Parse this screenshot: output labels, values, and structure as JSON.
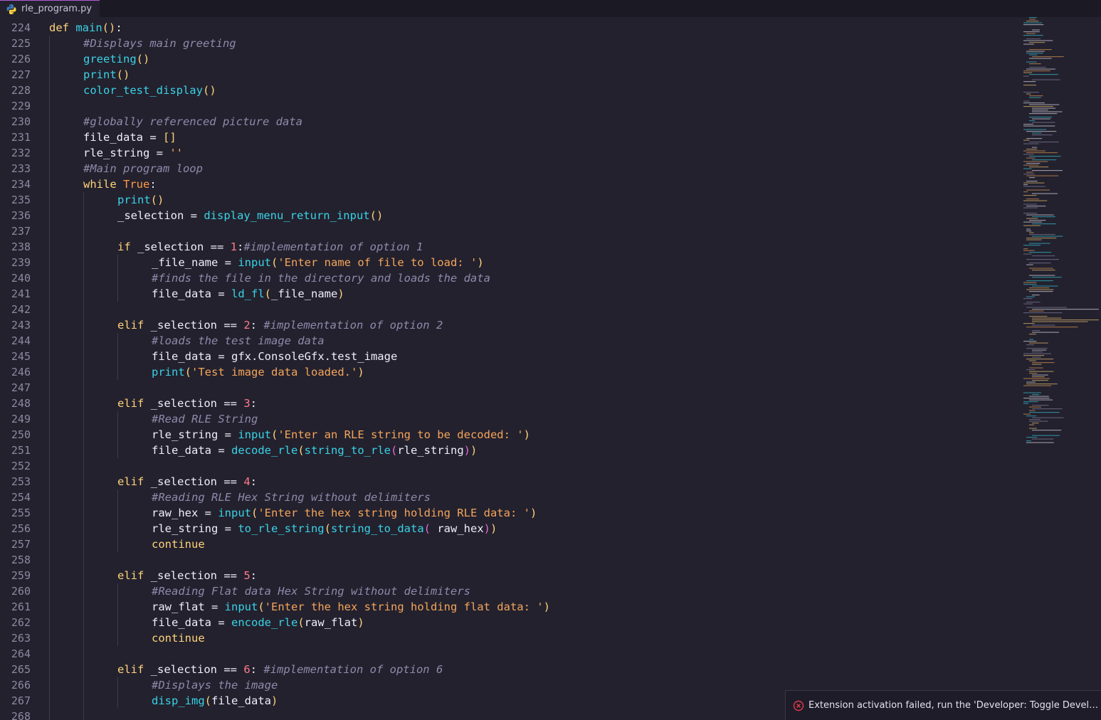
{
  "tab": {
    "filename": "rle_program.py",
    "icon": "python-icon"
  },
  "colors": {
    "background": "#23212e",
    "keyword": "#ffd479",
    "function": "#39d3e6",
    "comment": "#8f8aab",
    "string": "#f5a55a",
    "number": "#ff7a8a",
    "error": "#e03c48"
  },
  "code_lines": [
    {
      "n": "224",
      "indent": 0,
      "tokens": [
        [
          "kw",
          "def "
        ],
        [
          "fn",
          "main"
        ],
        [
          "p1",
          "()"
        ],
        [
          "op",
          ":"
        ]
      ]
    },
    {
      "n": "225",
      "indent": 1,
      "tokens": [
        [
          "cm",
          "#Displays main greeting"
        ]
      ]
    },
    {
      "n": "226",
      "indent": 1,
      "tokens": [
        [
          "fn",
          "greeting"
        ],
        [
          "p1",
          "()"
        ]
      ]
    },
    {
      "n": "227",
      "indent": 1,
      "tokens": [
        [
          "fn",
          "print"
        ],
        [
          "p1",
          "()"
        ]
      ]
    },
    {
      "n": "228",
      "indent": 1,
      "tokens": [
        [
          "fn",
          "color_test_display"
        ],
        [
          "p1",
          "()"
        ]
      ]
    },
    {
      "n": "229",
      "indent": 1,
      "tokens": []
    },
    {
      "n": "230",
      "indent": 1,
      "tokens": [
        [
          "cm",
          "#globally referenced picture data"
        ]
      ]
    },
    {
      "n": "231",
      "indent": 1,
      "tokens": [
        [
          "id",
          "file_data "
        ],
        [
          "op",
          "= "
        ],
        [
          "p1",
          "[]"
        ]
      ]
    },
    {
      "n": "232",
      "indent": 1,
      "tokens": [
        [
          "id",
          "rle_string "
        ],
        [
          "op",
          "= "
        ],
        [
          "st",
          "''"
        ]
      ]
    },
    {
      "n": "233",
      "indent": 1,
      "tokens": [
        [
          "cm",
          "#Main program loop"
        ]
      ]
    },
    {
      "n": "234",
      "indent": 1,
      "tokens": [
        [
          "kw",
          "while "
        ],
        [
          "bi",
          "True"
        ],
        [
          "op",
          ":"
        ]
      ]
    },
    {
      "n": "235",
      "indent": 2,
      "tokens": [
        [
          "fn",
          "print"
        ],
        [
          "p1",
          "()"
        ]
      ]
    },
    {
      "n": "236",
      "indent": 2,
      "tokens": [
        [
          "id",
          "_selection "
        ],
        [
          "op",
          "= "
        ],
        [
          "fn",
          "display_menu_return_input"
        ],
        [
          "p1",
          "()"
        ]
      ]
    },
    {
      "n": "237",
      "indent": 2,
      "tokens": []
    },
    {
      "n": "238",
      "indent": 2,
      "tokens": [
        [
          "kw",
          "if "
        ],
        [
          "id",
          "_selection "
        ],
        [
          "op",
          "== "
        ],
        [
          "nm",
          "1"
        ],
        [
          "op",
          ":"
        ],
        [
          "cm",
          "#implementation of option 1"
        ]
      ]
    },
    {
      "n": "239",
      "indent": 3,
      "tokens": [
        [
          "id",
          "_file_name "
        ],
        [
          "op",
          "= "
        ],
        [
          "fn",
          "input"
        ],
        [
          "p1",
          "("
        ],
        [
          "st",
          "'Enter name of file to load: '"
        ],
        [
          "p1",
          ")"
        ]
      ]
    },
    {
      "n": "240",
      "indent": 3,
      "tokens": [
        [
          "cm",
          "#finds the file in the directory and loads the data"
        ]
      ]
    },
    {
      "n": "241",
      "indent": 3,
      "tokens": [
        [
          "id",
          "file_data "
        ],
        [
          "op",
          "= "
        ],
        [
          "fn",
          "ld_fl"
        ],
        [
          "p1",
          "("
        ],
        [
          "id",
          "_file_name"
        ],
        [
          "p1",
          ")"
        ]
      ]
    },
    {
      "n": "242",
      "indent": 2,
      "tokens": []
    },
    {
      "n": "243",
      "indent": 2,
      "tokens": [
        [
          "kw",
          "elif "
        ],
        [
          "id",
          "_selection "
        ],
        [
          "op",
          "== "
        ],
        [
          "nm",
          "2"
        ],
        [
          "op",
          ": "
        ],
        [
          "cm",
          "#implementation of option 2"
        ]
      ]
    },
    {
      "n": "244",
      "indent": 3,
      "tokens": [
        [
          "cm",
          "#loads the test image data"
        ]
      ]
    },
    {
      "n": "245",
      "indent": 3,
      "tokens": [
        [
          "id",
          "file_data "
        ],
        [
          "op",
          "= "
        ],
        [
          "id",
          "gfx.ConsoleGfx.test_image"
        ]
      ]
    },
    {
      "n": "246",
      "indent": 3,
      "tokens": [
        [
          "fn",
          "print"
        ],
        [
          "p1",
          "("
        ],
        [
          "st",
          "'Test image data loaded.'"
        ],
        [
          "p1",
          ")"
        ]
      ]
    },
    {
      "n": "247",
      "indent": 2,
      "tokens": []
    },
    {
      "n": "248",
      "indent": 2,
      "tokens": [
        [
          "kw",
          "elif "
        ],
        [
          "id",
          "_selection "
        ],
        [
          "op",
          "== "
        ],
        [
          "nm",
          "3"
        ],
        [
          "op",
          ":"
        ]
      ]
    },
    {
      "n": "249",
      "indent": 3,
      "tokens": [
        [
          "cm",
          "#Read RLE String"
        ]
      ]
    },
    {
      "n": "250",
      "indent": 3,
      "tokens": [
        [
          "id",
          "rle_string "
        ],
        [
          "op",
          "= "
        ],
        [
          "fn",
          "input"
        ],
        [
          "p1",
          "("
        ],
        [
          "st",
          "'Enter an RLE string to be decoded: '"
        ],
        [
          "p1",
          ")"
        ]
      ]
    },
    {
      "n": "251",
      "indent": 3,
      "tokens": [
        [
          "id",
          "file_data "
        ],
        [
          "op",
          "= "
        ],
        [
          "fn",
          "decode_rle"
        ],
        [
          "p1",
          "("
        ],
        [
          "fn",
          "string_to_rle"
        ],
        [
          "p2",
          "("
        ],
        [
          "id",
          "rle_string"
        ],
        [
          "p2",
          ")"
        ],
        [
          "p1",
          ")"
        ]
      ]
    },
    {
      "n": "252",
      "indent": 2,
      "tokens": []
    },
    {
      "n": "253",
      "indent": 2,
      "tokens": [
        [
          "kw",
          "elif "
        ],
        [
          "id",
          "_selection "
        ],
        [
          "op",
          "== "
        ],
        [
          "nm",
          "4"
        ],
        [
          "op",
          ":"
        ]
      ]
    },
    {
      "n": "254",
      "indent": 3,
      "tokens": [
        [
          "cm",
          "#Reading RLE Hex String without delimiters"
        ]
      ]
    },
    {
      "n": "255",
      "indent": 3,
      "tokens": [
        [
          "id",
          "raw_hex "
        ],
        [
          "op",
          "= "
        ],
        [
          "fn",
          "input"
        ],
        [
          "p1",
          "("
        ],
        [
          "st",
          "'Enter the hex string holding RLE data: '"
        ],
        [
          "p1",
          ")"
        ]
      ]
    },
    {
      "n": "256",
      "indent": 3,
      "tokens": [
        [
          "id",
          "rle_string "
        ],
        [
          "op",
          "= "
        ],
        [
          "fn",
          "to_rle_string"
        ],
        [
          "p1",
          "("
        ],
        [
          "fn",
          "string_to_data"
        ],
        [
          "p2",
          "( "
        ],
        [
          "id",
          "raw_hex"
        ],
        [
          "p2",
          ")"
        ],
        [
          "p1",
          ")"
        ]
      ]
    },
    {
      "n": "257",
      "indent": 3,
      "tokens": [
        [
          "kw",
          "continue"
        ]
      ]
    },
    {
      "n": "258",
      "indent": 2,
      "tokens": []
    },
    {
      "n": "259",
      "indent": 2,
      "tokens": [
        [
          "kw",
          "elif "
        ],
        [
          "id",
          "_selection "
        ],
        [
          "op",
          "== "
        ],
        [
          "nm",
          "5"
        ],
        [
          "op",
          ":"
        ]
      ]
    },
    {
      "n": "260",
      "indent": 3,
      "tokens": [
        [
          "cm",
          "#Reading Flat data Hex String without delimiters"
        ]
      ]
    },
    {
      "n": "261",
      "indent": 3,
      "tokens": [
        [
          "id",
          "raw_flat "
        ],
        [
          "op",
          "= "
        ],
        [
          "fn",
          "input"
        ],
        [
          "p1",
          "("
        ],
        [
          "st",
          "'Enter the hex string holding flat data: '"
        ],
        [
          "p1",
          ")"
        ]
      ]
    },
    {
      "n": "262",
      "indent": 3,
      "tokens": [
        [
          "id",
          "file_data "
        ],
        [
          "op",
          "= "
        ],
        [
          "fn",
          "encode_rle"
        ],
        [
          "p1",
          "("
        ],
        [
          "id",
          "raw_flat"
        ],
        [
          "p1",
          ")"
        ]
      ]
    },
    {
      "n": "263",
      "indent": 3,
      "tokens": [
        [
          "kw",
          "continue"
        ]
      ]
    },
    {
      "n": "264",
      "indent": 2,
      "tokens": []
    },
    {
      "n": "265",
      "indent": 2,
      "tokens": [
        [
          "kw",
          "elif "
        ],
        [
          "id",
          "_selection "
        ],
        [
          "op",
          "== "
        ],
        [
          "nm",
          "6"
        ],
        [
          "op",
          ": "
        ],
        [
          "cm",
          "#implementation of option 6"
        ]
      ]
    },
    {
      "n": "266",
      "indent": 3,
      "tokens": [
        [
          "cm",
          "#Displays the image"
        ]
      ]
    },
    {
      "n": "267",
      "indent": 3,
      "tokens": [
        [
          "fn",
          "disp_img"
        ],
        [
          "p1",
          "("
        ],
        [
          "id",
          "file_data"
        ],
        [
          "p1",
          ")"
        ]
      ]
    },
    {
      "n": "268",
      "indent": 2,
      "tokens": []
    }
  ],
  "notification": {
    "message": "Extension activation failed, run the 'Developer: Toggle Developer Tools' command for more information.",
    "icon": "error-circle-icon"
  }
}
